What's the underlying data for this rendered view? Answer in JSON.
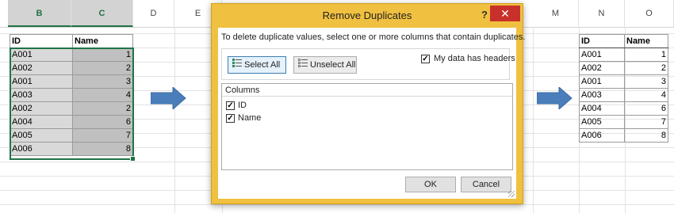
{
  "sheet": {
    "columns": [
      {
        "id": "col-b",
        "label": "B",
        "selected": true
      },
      {
        "id": "col-c",
        "label": "C",
        "selected": true
      },
      {
        "id": "col-d",
        "label": "D",
        "selected": false
      },
      {
        "id": "col-e",
        "label": "E",
        "selected": false
      },
      {
        "id": "col-m",
        "label": "M",
        "selected": false
      },
      {
        "id": "col-n",
        "label": "N",
        "selected": false
      },
      {
        "id": "col-o",
        "label": "O",
        "selected": false
      }
    ],
    "left_table": {
      "headers": [
        "ID",
        "Name"
      ],
      "rows": [
        [
          "A001",
          "1"
        ],
        [
          "A002",
          "2"
        ],
        [
          "A001",
          "3"
        ],
        [
          "A003",
          "4"
        ],
        [
          "A002",
          "2"
        ],
        [
          "A004",
          "6"
        ],
        [
          "A005",
          "7"
        ],
        [
          "A006",
          "8"
        ]
      ]
    },
    "right_table": {
      "headers": [
        "ID",
        "Name"
      ],
      "rows": [
        [
          "A001",
          "1"
        ],
        [
          "A002",
          "2"
        ],
        [
          "A001",
          "3"
        ],
        [
          "A003",
          "4"
        ],
        [
          "A004",
          "6"
        ],
        [
          "A005",
          "7"
        ],
        [
          "A006",
          "8"
        ]
      ]
    },
    "arrow_color": "#4a7ebb",
    "selection_color": "#217346"
  },
  "dialog": {
    "title": "Remove Duplicates",
    "help_label": "?",
    "close_label": "✕",
    "instruction": "To delete duplicate values, select one or more columns that contain duplicates.",
    "select_all_label": "Select All",
    "unselect_all_label": "Unselect All",
    "headers_checkbox_label": "My data has headers",
    "headers_checked": true,
    "columns_heading": "Columns",
    "column_options": [
      {
        "label": "ID",
        "checked": true
      },
      {
        "label": "Name",
        "checked": true
      }
    ],
    "ok_label": "OK",
    "cancel_label": "Cancel",
    "accent_color": "#f0c040"
  }
}
